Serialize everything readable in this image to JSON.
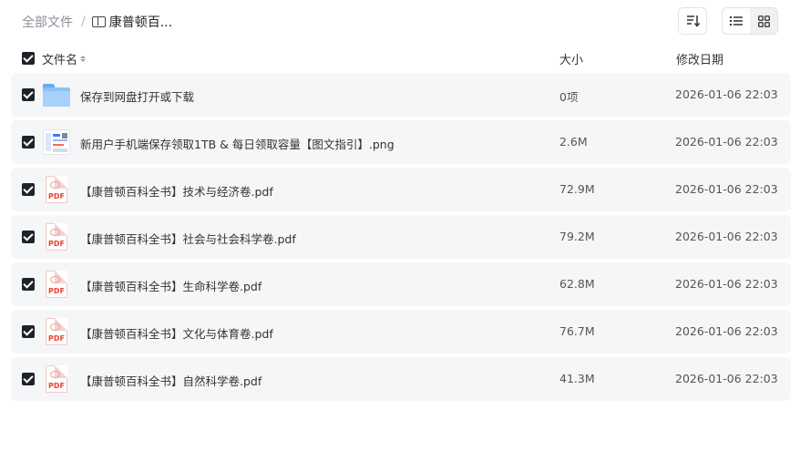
{
  "breadcrumb": {
    "root": "全部文件",
    "separator": "/",
    "current": "康普顿百..."
  },
  "header": {
    "name": "文件名",
    "size": "大小",
    "date": "修改日期"
  },
  "colors": {
    "checkbox": "#1f2329",
    "row_bg": "#f5f6f7",
    "folder": "#8cc2f8",
    "pdf_label": "#e8432f"
  },
  "files": [
    {
      "icon": "folder-icon",
      "name": "保存到网盘打开或下载",
      "size": "0项",
      "date": "2026-01-06 22:03"
    },
    {
      "icon": "image-thumbnail-icon",
      "name": "新用户手机端保存领取1TB & 每日领取容量【图文指引】.png",
      "size": "2.6M",
      "date": "2026-01-06 22:03"
    },
    {
      "icon": "pdf-icon",
      "icon_label": "PDF",
      "name": "【康普顿百科全书】技术与经济卷.pdf",
      "size": "72.9M",
      "date": "2026-01-06 22:03"
    },
    {
      "icon": "pdf-icon",
      "icon_label": "PDF",
      "name": "【康普顿百科全书】社会与社会科学卷.pdf",
      "size": "79.2M",
      "date": "2026-01-06 22:03"
    },
    {
      "icon": "pdf-icon",
      "icon_label": "PDF",
      "name": "【康普顿百科全书】生命科学卷.pdf",
      "size": "62.8M",
      "date": "2026-01-06 22:03"
    },
    {
      "icon": "pdf-icon",
      "icon_label": "PDF",
      "name": "【康普顿百科全书】文化与体育卷.pdf",
      "size": "76.7M",
      "date": "2026-01-06 22:03"
    },
    {
      "icon": "pdf-icon",
      "icon_label": "PDF",
      "name": "【康普顿百科全书】自然科学卷.pdf",
      "size": "41.3M",
      "date": "2026-01-06 22:03"
    }
  ]
}
